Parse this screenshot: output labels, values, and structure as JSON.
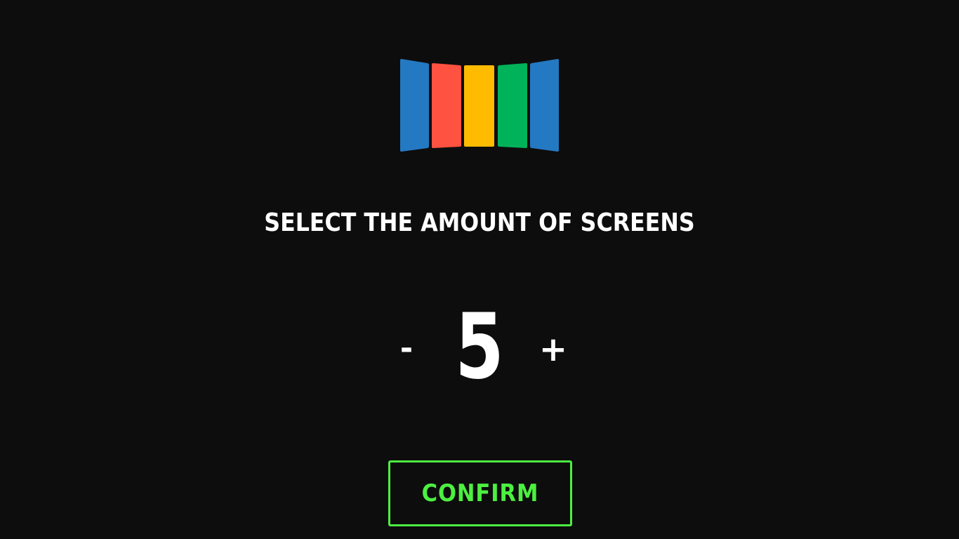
{
  "logo": {
    "icon": "screens-logo-icon",
    "panel_colors": [
      "#2479c3",
      "#ff5240",
      "#ffbb00",
      "#00b259",
      "#2479c3"
    ]
  },
  "title": "SELECT THE AMOUNT OF SCREENS",
  "stepper": {
    "decrement_label": "-",
    "value": "5",
    "increment_label": "+"
  },
  "confirm": {
    "label": "CONFIRM",
    "color": "#4cf040"
  },
  "background": "#0d0d0d"
}
